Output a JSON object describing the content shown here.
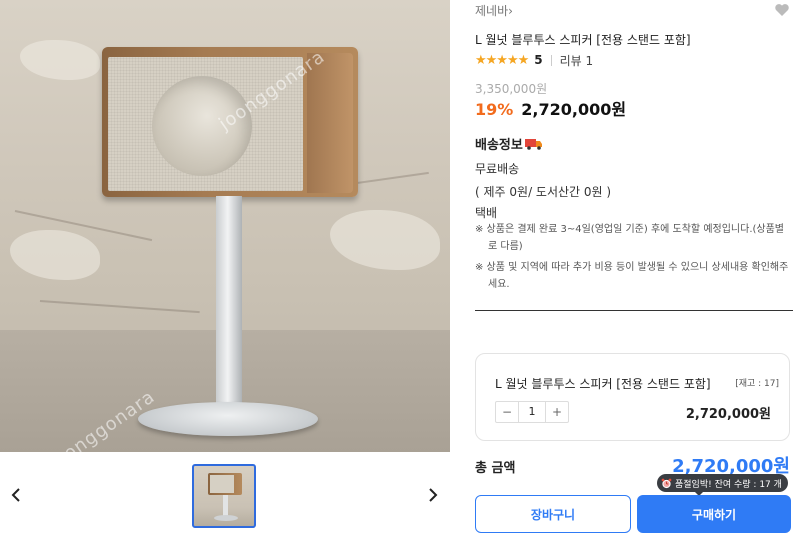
{
  "product": {
    "store_name": "제네바",
    "store_chevron": "›",
    "title": "L 월넛 블루투스 스피커 [전용 스탠드 포함]",
    "stars": "★★★★★",
    "rating": "5",
    "review_label": "리뷰 1",
    "original_price": "3,350,000원",
    "discount": "19%",
    "price": "2,720,000원",
    "image_watermark": "joonggonara"
  },
  "gallery": {
    "prev_icon": "chevron-left-icon",
    "next_icon": "chevron-right-icon",
    "thumbnails": 1
  },
  "shipping": {
    "title": "배송정보",
    "free_label": "무료배송",
    "fee_detail": "( 제주 0원/ 도서산간 0원 )",
    "method": "택배",
    "note1": "※ 상품은 결제 완료 3~4일(영업일 기준) 후에 도착할 예정입니다.(상품별로 다름)",
    "note2": "※ 상품 및 지역에 따라 추가 비용 등이 발생될 수 있으니 상세내용 확인해주세요."
  },
  "option": {
    "name": "L 월넛 블루투스 스피커 [전용 스탠드 포함]",
    "stock": "[재고 : 17]",
    "minus": "−",
    "quantity": "1",
    "plus": "+",
    "price": "2,720,000원"
  },
  "total": {
    "label": "총 금액",
    "price": "2,720,000원"
  },
  "tooltip": {
    "text": "품절임박! 잔여 수량 : 17 개"
  },
  "buttons": {
    "cart": "장바구니",
    "buy": "구매하기"
  },
  "colors": {
    "accent": "#2f7bf5",
    "discount": "#f26b1d",
    "star": "#f5a623",
    "thumb_border": "#2f6bde"
  }
}
